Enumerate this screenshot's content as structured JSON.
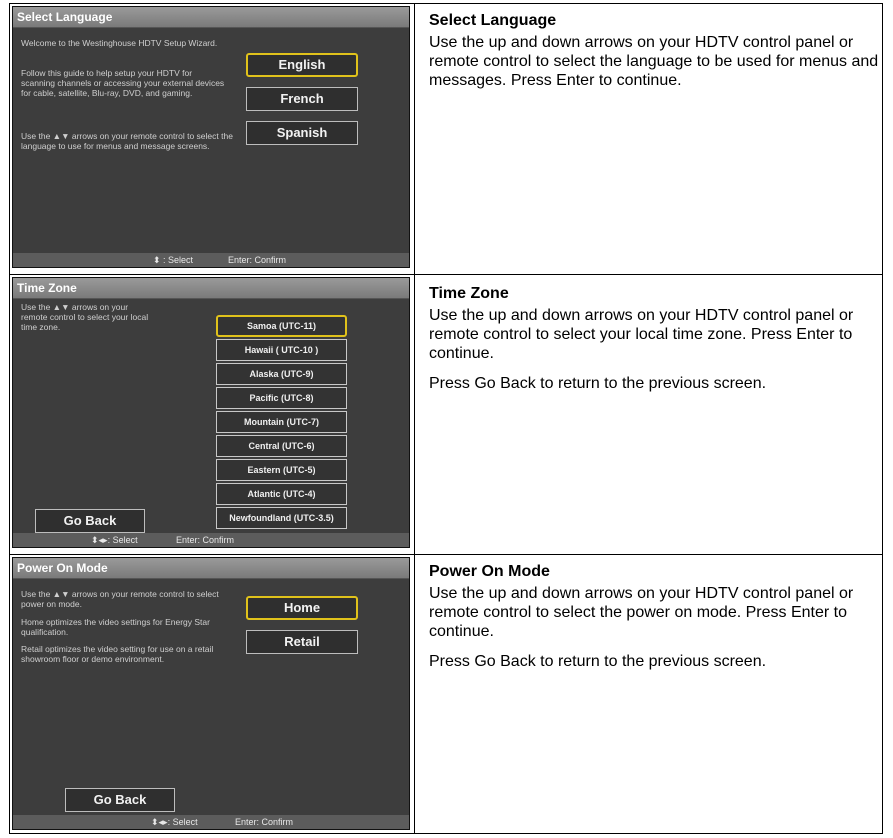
{
  "rows": [
    {
      "screen": {
        "title": "Select Language",
        "paragraphs": [
          "Welcome to the Westinghouse HDTV Setup Wizard.",
          "Follow this guide to help setup your HDTV for scanning channels or accessing your external devices for cable, satellite, Blu-ray, DVD, and gaming.",
          "Use the ▲▼ arrows on your remote control to select the language to use for menus and message screens."
        ],
        "options": [
          "English",
          "French",
          "Spanish"
        ],
        "footer_select": "⬍ : Select",
        "footer_confirm": "Enter: Confirm"
      },
      "heading": "Select Language",
      "description": [
        "Use the up and down arrows on your HDTV control panel or remote control to select the language to be used for menus and messages. Press Enter to continue."
      ]
    },
    {
      "screen": {
        "title": "Time Zone",
        "paragraphs": [
          "Use the ▲▼ arrows on your remote control to select your local time zone."
        ],
        "options": [
          "Samoa (UTC-11)",
          "Hawaii ( UTC-10 )",
          "Alaska (UTC-9)",
          "Pacific (UTC-8)",
          "Mountain (UTC-7)",
          "Central (UTC-6)",
          "Eastern (UTC-5)",
          "Atlantic (UTC-4)",
          "Newfoundland (UTC-3.5)"
        ],
        "go_back": "Go Back",
        "footer_select": "⬍◂▸: Select",
        "footer_confirm": "Enter: Confirm"
      },
      "heading": "Time Zone",
      "description": [
        "Use the up and down arrows on your HDTV control panel or remote control to select your local time zone. Press Enter to continue.",
        "Press Go Back to return to the previous screen."
      ]
    },
    {
      "screen": {
        "title": "Power On Mode",
        "paragraphs": [
          "Use the ▲▼ arrows on your remote control to select power on mode.",
          "Home optimizes the video settings for Energy Star qualification.",
          "Retail optimizes the video setting for use on a retail showroom floor or demo environment."
        ],
        "options": [
          "Home",
          "Retail"
        ],
        "go_back": "Go Back",
        "footer_select": "⬍◂▸: Select",
        "footer_confirm": "Enter: Confirm"
      },
      "heading": "Power On Mode",
      "description": [
        "Use the up and down arrows on your HDTV control panel or remote control to select the power on mode. Press Enter to continue.",
        "Press Go Back to return to the previous screen."
      ]
    }
  ]
}
